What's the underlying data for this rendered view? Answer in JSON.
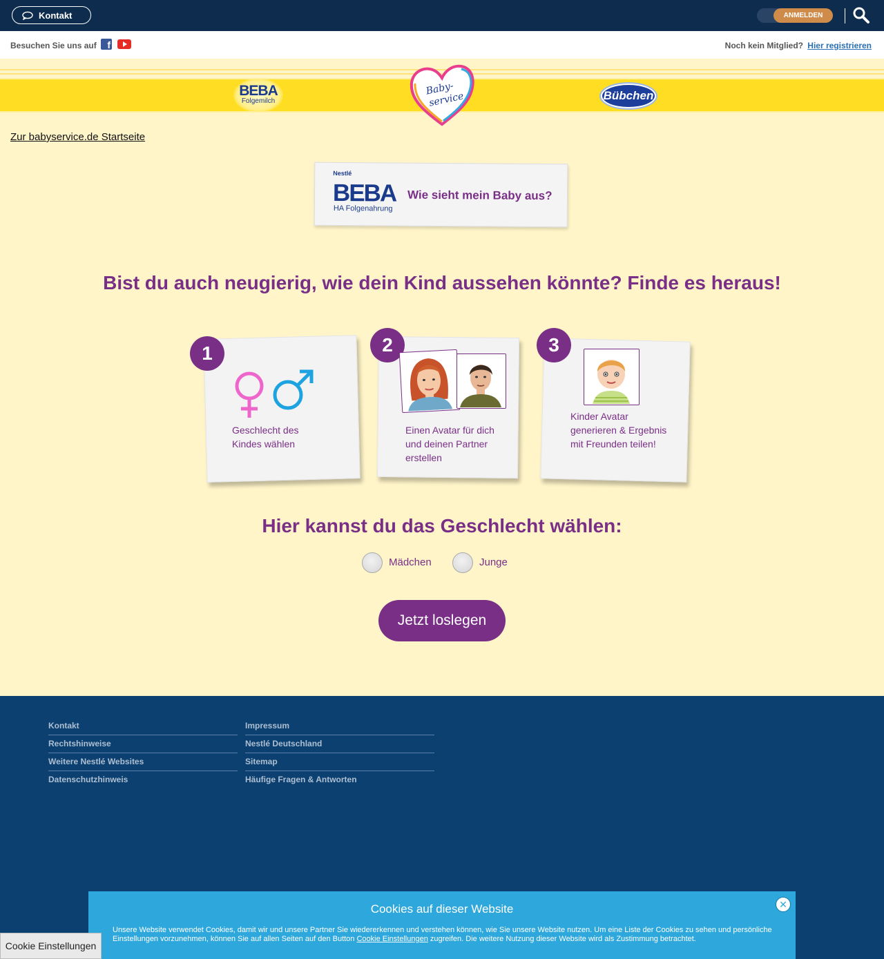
{
  "topbar": {
    "kontakt_label": "Kontakt",
    "login_label": "ANMELDEN"
  },
  "socialbar": {
    "visit_text": "Besuchen Sie uns auf",
    "no_member_text": "Noch kein Mitglied?",
    "register_link": "Hier registrieren"
  },
  "brands": {
    "beba_name": "BEBA",
    "beba_sub": "Folgemilch",
    "babyservice_line1": "Baby-",
    "babyservice_line2": "service",
    "bubchen_name": "Bübchen"
  },
  "home_link": "Zur babyservice.de Startseite",
  "banner": {
    "brand_top": "Nestlé",
    "brand": "BEBA",
    "brand_sub": "HA Folgenahrung",
    "title": "Wie sieht mein Baby aus?"
  },
  "main_heading": "Bist du auch neugierig, wie dein Kind aussehen könnte? Finde es heraus!",
  "steps": [
    {
      "number": "1",
      "text_line1": "Geschlecht des",
      "text_line2": "Kindes wählen",
      "text_line3": ""
    },
    {
      "number": "2",
      "text_line1": "Einen Avatar für dich",
      "text_line2": "und deinen Partner",
      "text_line3": "erstellen"
    },
    {
      "number": "3",
      "text_line1": "Kinder Avatar",
      "text_line2": "generieren & Ergebnis",
      "text_line3": "mit Freunden teilen!"
    }
  ],
  "gender": {
    "heading": "Hier kannst du das Geschlecht wählen:",
    "options": [
      {
        "label": "Mädchen",
        "selected": false
      },
      {
        "label": "Junge",
        "selected": false
      }
    ]
  },
  "start_button": "Jetzt loslegen",
  "footer": {
    "col1": [
      "Kontakt",
      "Rechtshinweise",
      "Weitere Nestlé Websites",
      "Datenschutzhinweis"
    ],
    "col2": [
      "Impressum",
      "Nestlé Deutschland",
      "Sitemap",
      "Häufige Fragen & Antworten"
    ]
  },
  "cookie": {
    "title": "Cookies auf dieser Website",
    "text_before": "Unsere Website verwendet Cookies, damit wir und unsere Partner Sie wiedererkennen und verstehen können, wie Sie unsere Website nutzen. Um eine Liste der Cookies zu sehen und persönliche Einstellungen vorzunehmen, können Sie auf allen Seiten auf den Button ",
    "text_link": "Cookie Einstellungen",
    "text_after": " zugreifen. Die weitere Nutzung dieser Website wird als Zustimmung betrachtet.",
    "settings_button": "Cookie Einstellungen",
    "close_symbol": "✕"
  },
  "colors": {
    "accent_purple": "#7a2f87",
    "navy": "#0e2c4e",
    "footer_blue": "#0c4070",
    "cookie_blue": "#2ea8dc",
    "background": "#fff5c9"
  },
  "icons": [
    "chat-bubble-icon",
    "search-icon",
    "facebook-icon",
    "youtube-icon",
    "female-symbol-icon",
    "male-symbol-icon",
    "close-icon"
  ]
}
